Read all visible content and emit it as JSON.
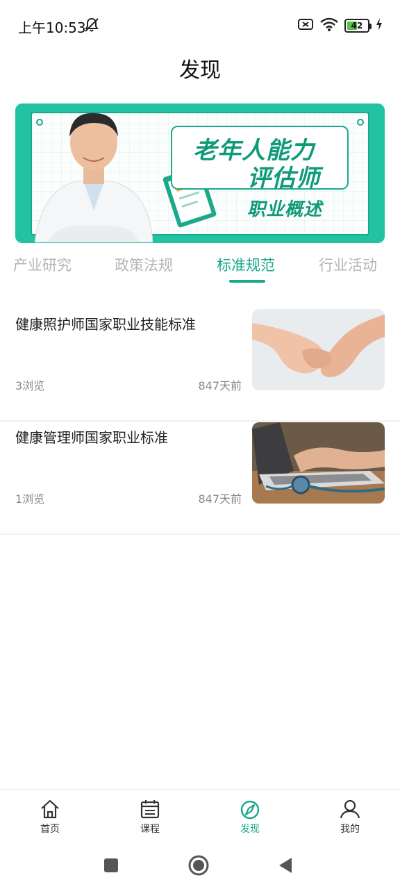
{
  "status_bar": {
    "time": "上午10:53",
    "battery_level": "42",
    "icons": [
      "mute-icon",
      "sim-error-icon",
      "wifi-icon",
      "battery-icon",
      "charging-icon"
    ]
  },
  "header": {
    "title": "发现"
  },
  "banner": {
    "title_line1": "老年人能力",
    "title_line2": "评估师",
    "subtitle": "职业概述",
    "colors": {
      "primary": "#22c3a2",
      "text": "#0f9a7a"
    }
  },
  "tabs": [
    {
      "label": "产业研究",
      "active": false
    },
    {
      "label": "政策法规",
      "active": false
    },
    {
      "label": "标准规范",
      "active": true
    },
    {
      "label": "行业活动",
      "active": false
    }
  ],
  "articles": [
    {
      "title": "健康照护师国家职业技能标准",
      "views": "3浏览",
      "time": "847天前",
      "thumb": "holding-hands-image"
    },
    {
      "title": "健康管理师国家职业标准",
      "views": "1浏览",
      "time": "847天前",
      "thumb": "laptop-stethoscope-image"
    }
  ],
  "bottom_nav": [
    {
      "label": "首页",
      "icon": "home-icon",
      "active": false
    },
    {
      "label": "课程",
      "icon": "calendar-icon",
      "active": false
    },
    {
      "label": "发现",
      "icon": "compass-icon",
      "active": true
    },
    {
      "label": "我的",
      "icon": "user-icon",
      "active": false
    }
  ],
  "accent_color": "#17a98a"
}
